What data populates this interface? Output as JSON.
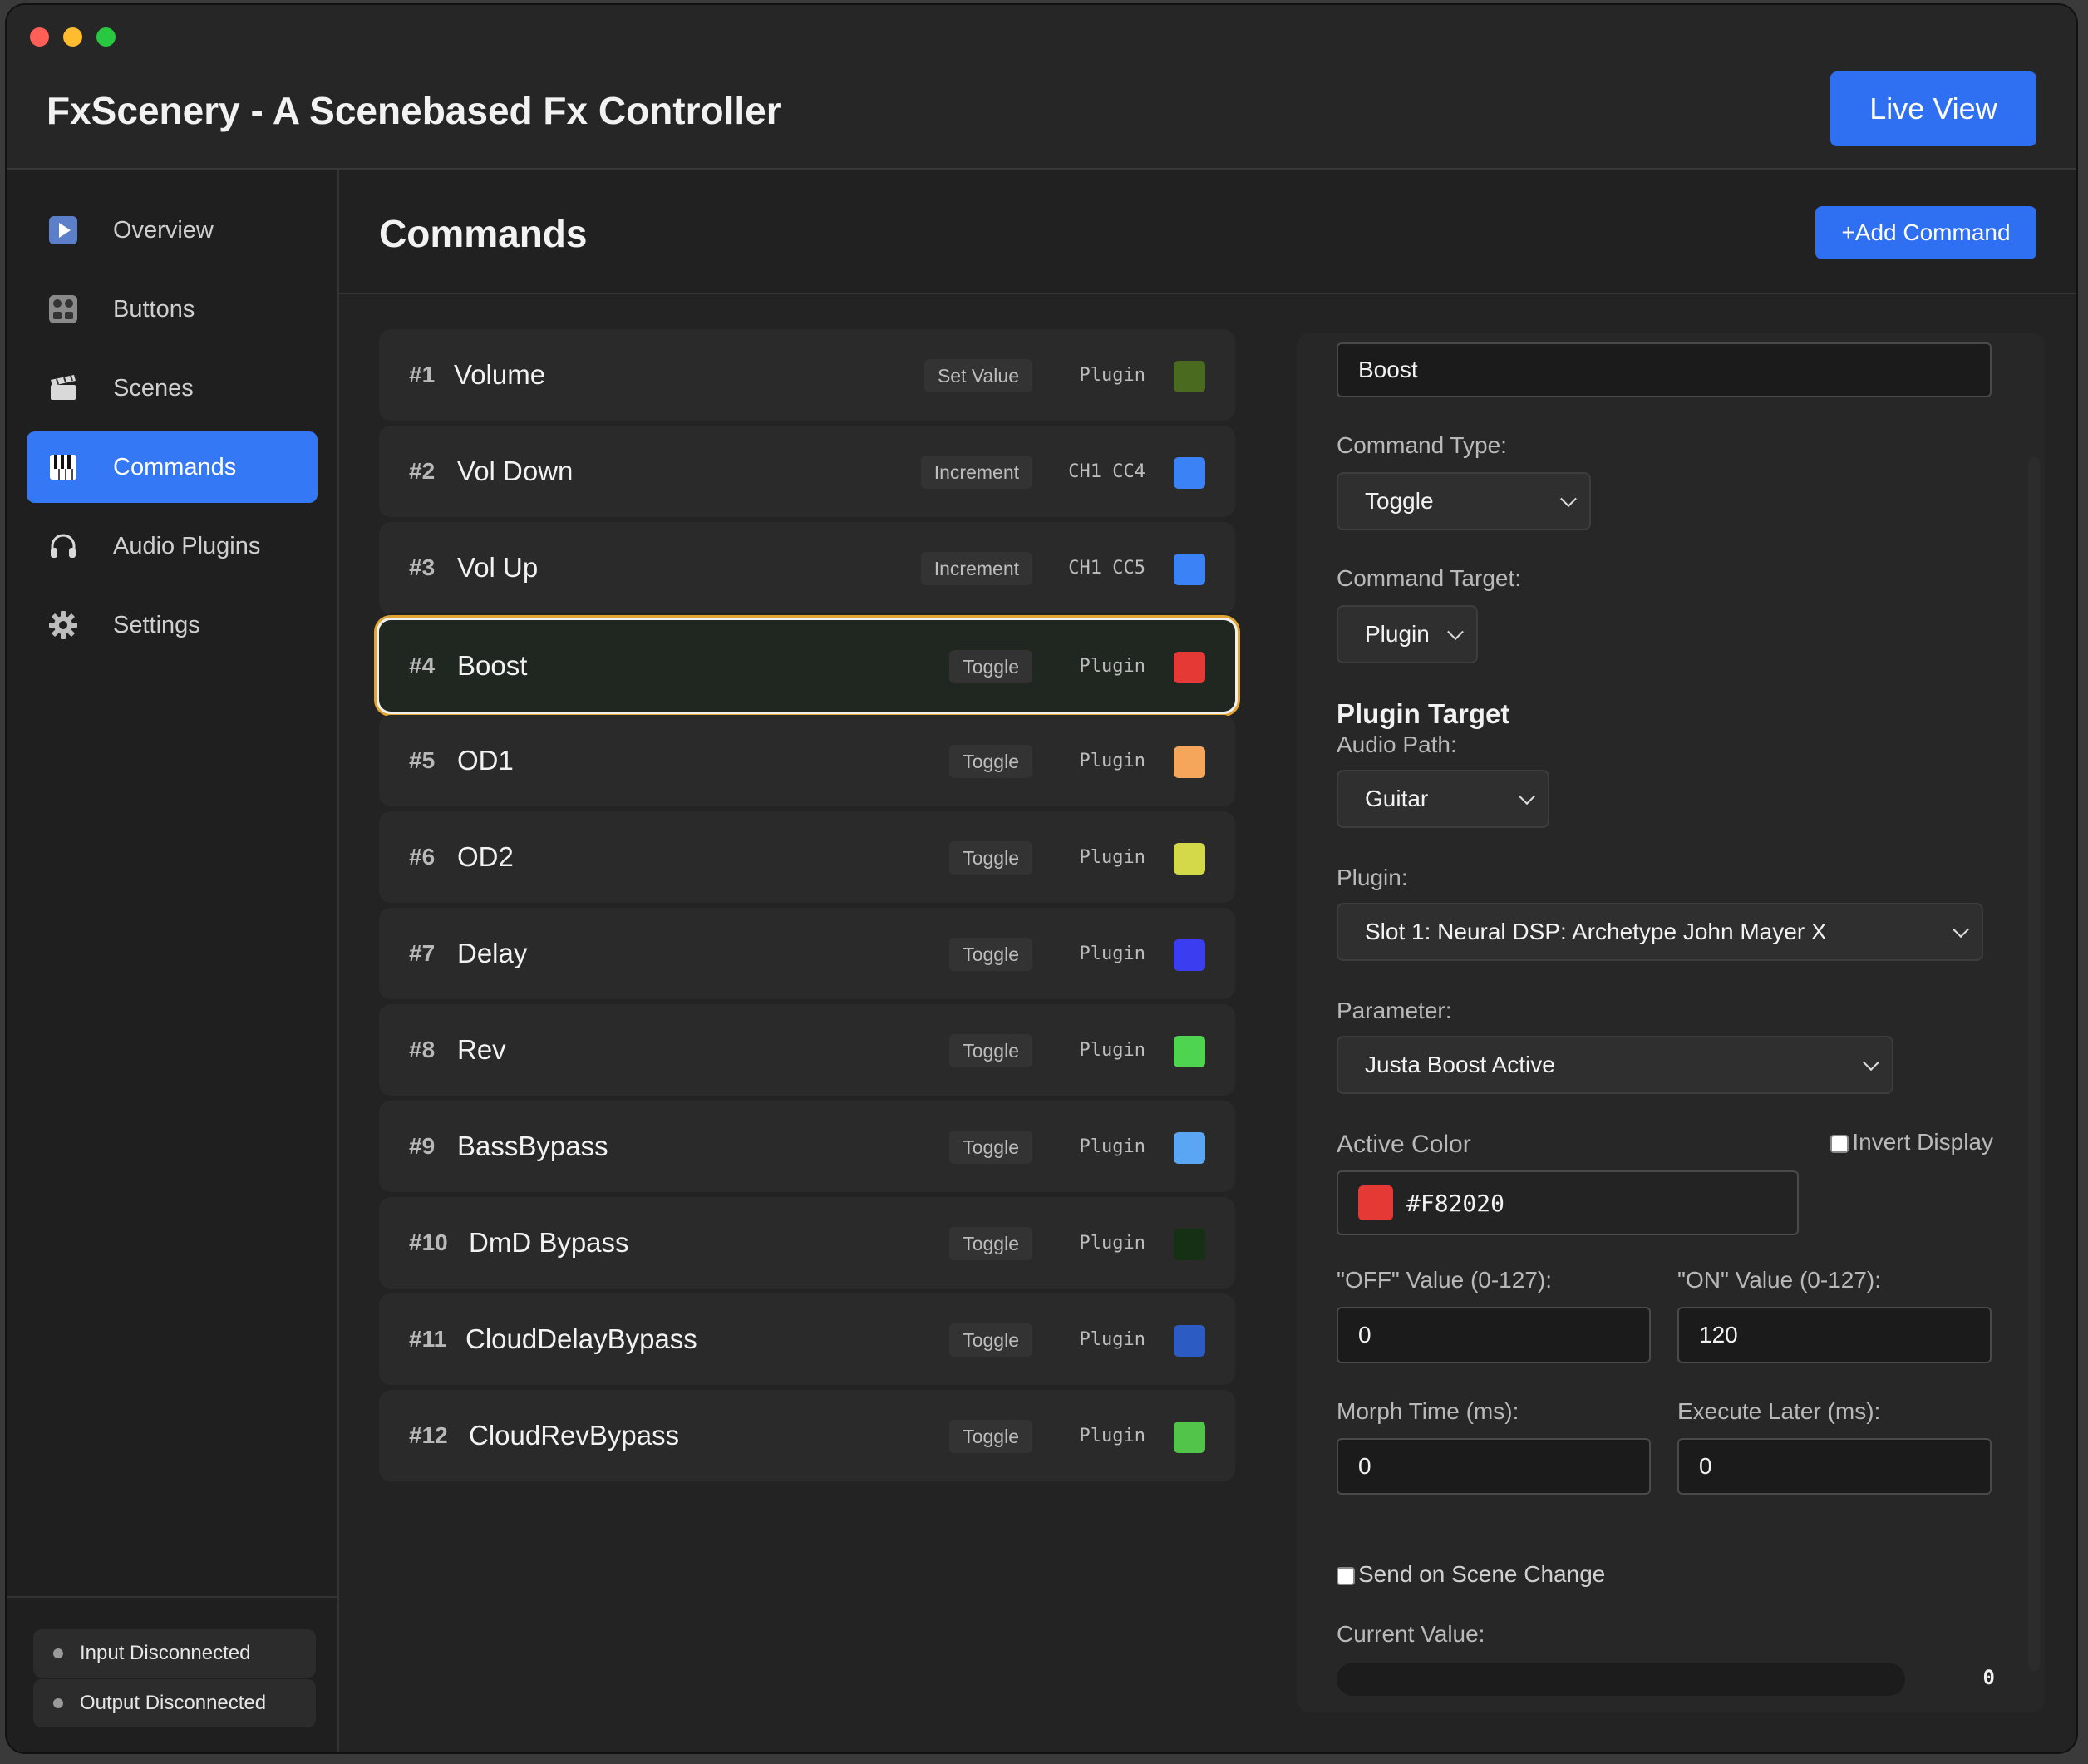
{
  "app": {
    "title": "FxScenery - A Scenebased Fx Controller",
    "live_view_label": "Live View"
  },
  "sidebar": {
    "items": [
      {
        "label": "Overview",
        "icon": "play-icon"
      },
      {
        "label": "Buttons",
        "icon": "buttons-grid-icon"
      },
      {
        "label": "Scenes",
        "icon": "clapperboard-icon"
      },
      {
        "label": "Commands",
        "icon": "piano-keys-icon",
        "active": true
      },
      {
        "label": "Audio Plugins",
        "icon": "headphones-icon"
      },
      {
        "label": "Settings",
        "icon": "gear-icon"
      }
    ],
    "status": [
      {
        "label": "Input Disconnected"
      },
      {
        "label": "Output Disconnected"
      }
    ]
  },
  "main": {
    "title": "Commands",
    "add_button_label": "+Add Command",
    "commands": [
      {
        "num": "#1",
        "name": "Volume",
        "type": "Set Value",
        "target": "Plugin",
        "color": "#4a6b1f"
      },
      {
        "num": "#2",
        "name": "Vol Down",
        "type": "Increment",
        "target": "CH1 CC4",
        "color": "#3b82f6"
      },
      {
        "num": "#3",
        "name": "Vol Up",
        "type": "Increment",
        "target": "CH1 CC5",
        "color": "#3b82f6"
      },
      {
        "num": "#4",
        "name": "Boost",
        "type": "Toggle",
        "target": "Plugin",
        "color": "#e53935",
        "selected": true
      },
      {
        "num": "#5",
        "name": "OD1",
        "type": "Toggle",
        "target": "Plugin",
        "color": "#f5a65b"
      },
      {
        "num": "#6",
        "name": "OD2",
        "type": "Toggle",
        "target": "Plugin",
        "color": "#d4d94a"
      },
      {
        "num": "#7",
        "name": "Delay",
        "type": "Toggle",
        "target": "Plugin",
        "color": "#3b3ef0"
      },
      {
        "num": "#8",
        "name": "Rev",
        "type": "Toggle",
        "target": "Plugin",
        "color": "#4fd44f"
      },
      {
        "num": "#9",
        "name": "BassBypass",
        "type": "Toggle",
        "target": "Plugin",
        "color": "#5aa6f5"
      },
      {
        "num": "#10",
        "name": "DmD Bypass",
        "type": "Toggle",
        "target": "Plugin",
        "color": "#163016"
      },
      {
        "num": "#11",
        "name": "CloudDelayBypass",
        "type": "Toggle",
        "target": "Plugin",
        "color": "#2c5bc4"
      },
      {
        "num": "#12",
        "name": "CloudRevBypass",
        "type": "Toggle",
        "target": "Plugin",
        "color": "#52c44a"
      }
    ]
  },
  "editor": {
    "name_value": "Boost",
    "command_type_label": "Command Type:",
    "command_type_value": "Toggle",
    "command_target_label": "Command Target:",
    "command_target_value": "Plugin",
    "plugin_target_title": "Plugin Target",
    "audio_path_label": "Audio Path:",
    "audio_path_value": "Guitar",
    "plugin_label": "Plugin:",
    "plugin_value": "Slot 1: Neural DSP: Archetype John Mayer X",
    "parameter_label": "Parameter:",
    "parameter_value": "Justa Boost Active",
    "active_color_label": "Active Color",
    "invert_display_label": "Invert Display",
    "active_color_value": "#F82020",
    "active_color_swatch": "#e53935",
    "off_value_label": "\"OFF\" Value (0-127):",
    "off_value": "0",
    "on_value_label": "\"ON\" Value (0-127):",
    "on_value": "120",
    "morph_time_label": "Morph Time (ms):",
    "morph_time_value": "0",
    "execute_later_label": "Execute Later (ms):",
    "execute_later_value": "0",
    "send_on_scene_change_label": "Send on Scene Change",
    "current_value_label": "Current Value:",
    "current_value": "0"
  }
}
